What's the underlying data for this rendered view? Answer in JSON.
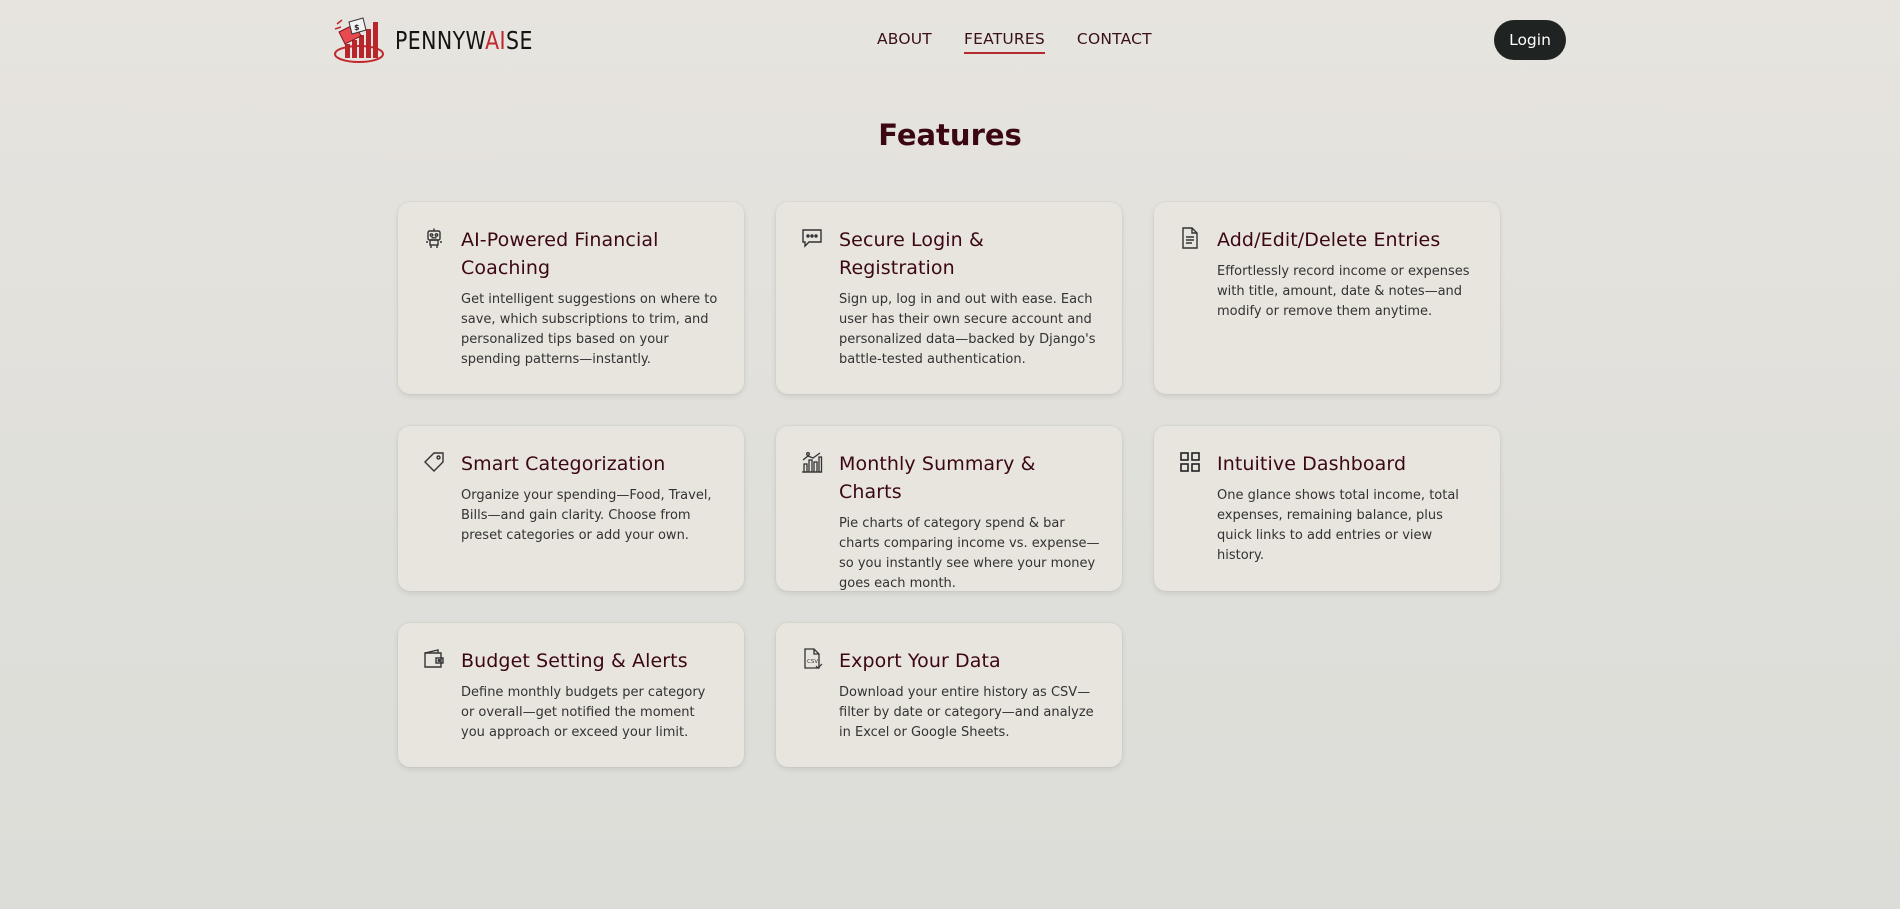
{
  "brand": {
    "name_prefix": "PENNYW",
    "name_highlight": "AI",
    "name_suffix": "SE",
    "logo_icon": "money-chart-logo-icon"
  },
  "nav": {
    "about": "ABOUT",
    "features": "FEATURES",
    "contact": "CONTACT",
    "active": "FEATURES"
  },
  "login_label": "Login",
  "page_title": "Features",
  "colors": {
    "accent": "#b52a30",
    "title": "#3b0812",
    "button_bg": "#1f2423"
  },
  "features": [
    {
      "icon": "robot-icon",
      "title": "AI-Powered Financial Coaching",
      "description": "Get intelligent suggestions on where to save, which subscriptions to trim, and personalized tips based on your spending patterns—instantly."
    },
    {
      "icon": "chat-bubble-icon",
      "title": "Secure Login & Registration",
      "description": "Sign up, log in and out with ease. Each user has their own secure account and personalized data—backed by Django's battle-tested authentication."
    },
    {
      "icon": "document-icon",
      "title": "Add/Edit/Delete Entries",
      "description": "Effortlessly record income or expenses with title, amount, date & notes—and modify or remove them anytime."
    },
    {
      "icon": "tag-icon",
      "title": "Smart Categorization",
      "description": "Organize your spending—Food, Travel, Bills—and gain clarity. Choose from preset categories or add your own."
    },
    {
      "icon": "bar-chart-icon",
      "title": "Monthly Summary & Charts",
      "description": "Pie charts of category spend & bar charts comparing income vs. expense—so you instantly see where your money goes each month."
    },
    {
      "icon": "dashboard-grid-icon",
      "title": "Intuitive Dashboard",
      "description": "One glance shows total income, total expenses, remaining balance, plus quick links to add entries or view history."
    },
    {
      "icon": "wallet-icon",
      "title": "Budget Setting & Alerts",
      "description": "Define monthly budgets per category or overall—get notified the moment you approach or exceed your limit."
    },
    {
      "icon": "csv-file-icon",
      "title": "Export Your Data",
      "description": "Download your entire history as CSV—filter by date or category—and analyze in Excel or Google Sheets."
    }
  ]
}
